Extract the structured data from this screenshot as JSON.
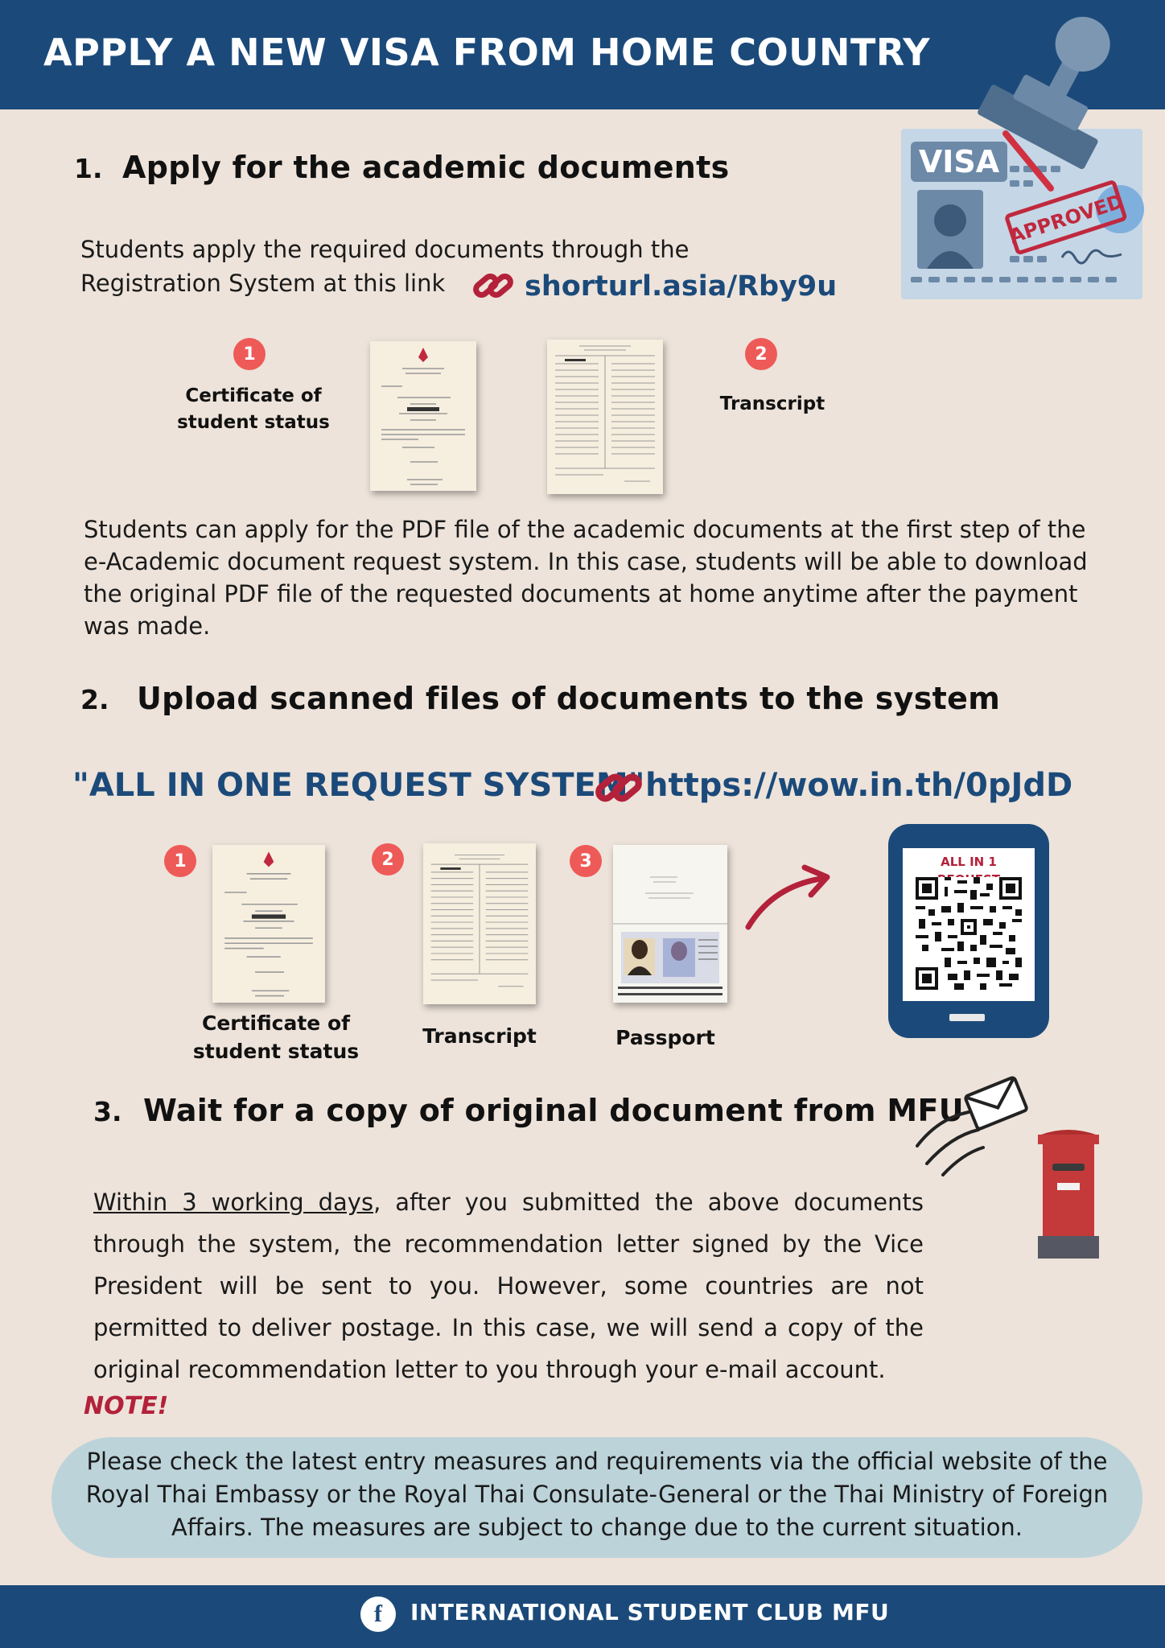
{
  "header": {
    "title": "APPLY A NEW VISA FROM HOME COUNTRY"
  },
  "visa_card": {
    "visa_label": "VISA",
    "stamp_text": "APPROVED"
  },
  "section1": {
    "number": "1.",
    "title": "Apply for the academic documents",
    "intro_line1": "Students apply the required documents through the",
    "intro_line2": "Registration System at this link",
    "link": "shorturl.asia/Rby9u",
    "docs": [
      {
        "badge": "1",
        "label_line1": "Certificate of",
        "label_line2": "student status"
      },
      {
        "badge": "2",
        "label": "Transcript"
      }
    ],
    "paragraph": "Students can apply for the PDF file of the academic documents at the first step of the e-Academic document request system. In this case, students will be able to download the original PDF file of the requested documents at home anytime after the payment was made."
  },
  "section2": {
    "number": "2.",
    "title": "Upload scanned files of documents to the system",
    "system_name": "\"ALL IN ONE REQUEST SYSTEM\"",
    "link": "https://wow.in.th/0pJdD",
    "docs": [
      {
        "badge": "1",
        "label_line1": "Certificate of",
        "label_line2": "student status"
      },
      {
        "badge": "2",
        "label": "Transcript"
      },
      {
        "badge": "3",
        "label": "Passport"
      }
    ],
    "phone_tag": "ALL IN 1 REQUEST"
  },
  "section3": {
    "number": "3.",
    "title": "Wait for a copy of original document from MFU",
    "underlined_lead": "Within 3 working days",
    "paragraph_rest": ", after you submitted the above documents through the system, the recommendation letter signed by the Vice President will be sent to you. However, some countries are not permitted to deliver postage. In this case, we will send a copy of the original recommendation letter to you through your e-mail account."
  },
  "note": {
    "label": "NOTE!",
    "text": "Please check the latest entry measures and requirements via the official website of the Royal Thai Embassy or the Royal Thai Consulate-General or the Thai Ministry of Foreign Affairs. The measures are subject to change due to the current situation."
  },
  "footer": {
    "icon": "facebook-icon",
    "text": "INTERNATIONAL STUDENT CLUB MFU"
  },
  "colors": {
    "navy": "#1b4a7a",
    "background": "#ede3da",
    "badge_red": "#ee5a57",
    "link_icon_red": "#b3213a",
    "note_box": "#bcd3da"
  }
}
